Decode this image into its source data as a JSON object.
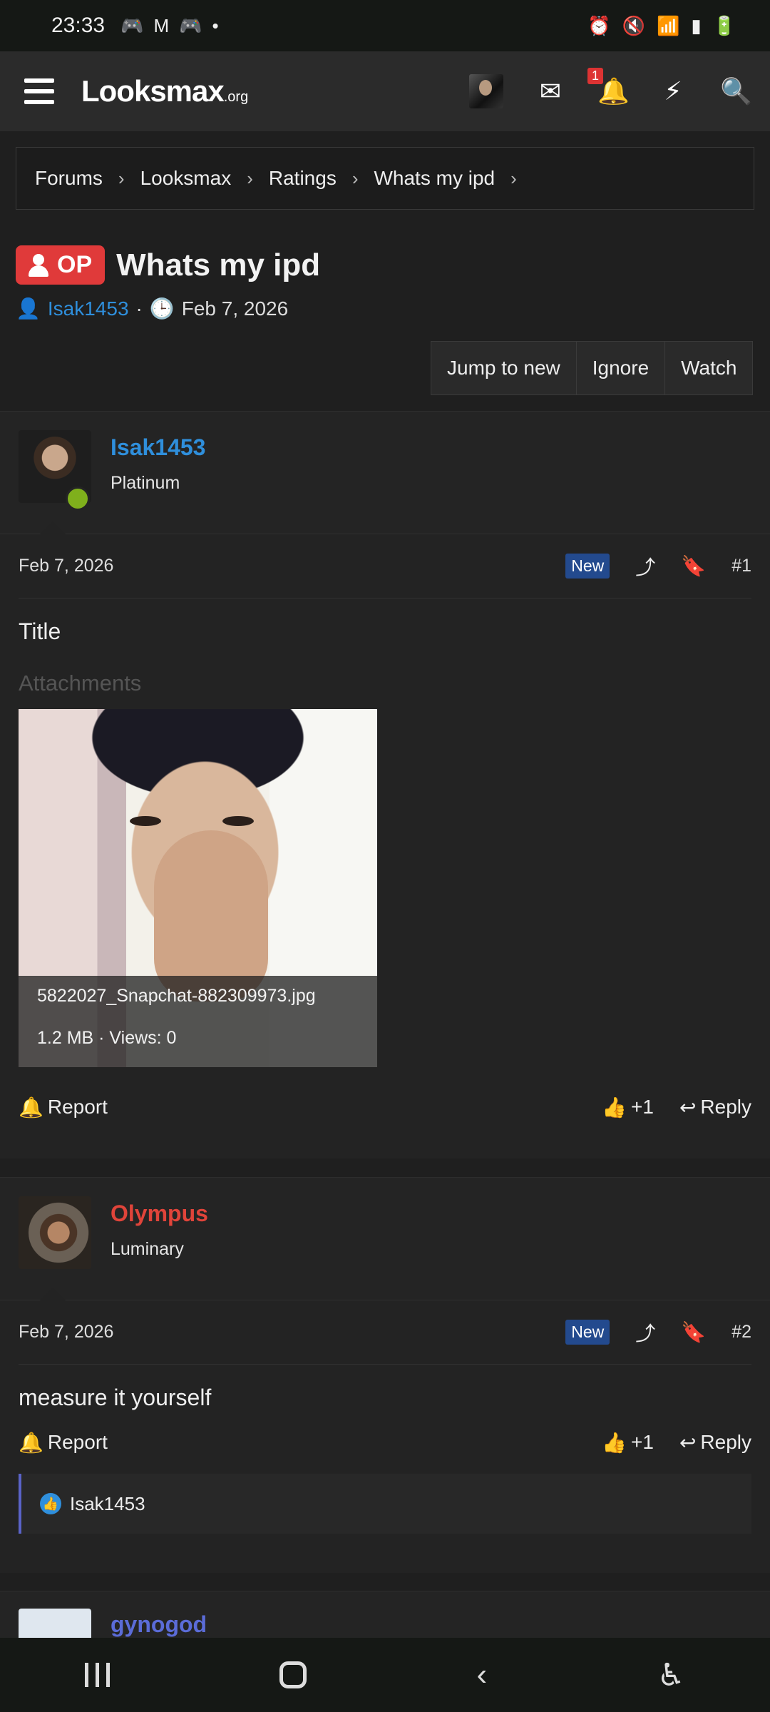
{
  "status": {
    "time": "23:33",
    "left_icons": [
      "game-icon",
      "gmail-icon",
      "game-icon",
      "dot"
    ],
    "right_icons": [
      "alarm-icon",
      "mute-icon",
      "wifi-icon",
      "signal-icon",
      "battery-icon"
    ]
  },
  "nav": {
    "logo": "Looksmax",
    "logo_suffix": ".org",
    "notif_count": "1"
  },
  "breadcrumb": [
    "Forums",
    "Looksmax",
    "Ratings",
    "Whats my ipd"
  ],
  "thread": {
    "op_label": "OP",
    "title": "Whats my ipd",
    "author": "Isak1453",
    "date": "Feb 7, 2026",
    "buttons": {
      "jump": "Jump to new",
      "ignore": "Ignore",
      "watch": "Watch"
    }
  },
  "posts": [
    {
      "name": "Isak1453",
      "name_color": "#2f8fdc",
      "rank": "Platinum",
      "date": "Feb 7, 2026",
      "new_label": "New",
      "number": "#1",
      "body": "Title",
      "attachments_label": "Attachments",
      "attachment_file": "5822027_Snapchat-882309973.jpg",
      "attachment_meta": "1.2 MB · Views: 0",
      "report": "Report",
      "like": "+1",
      "reply": "Reply"
    },
    {
      "name": "Olympus",
      "name_color": "#e0443a",
      "rank": "Luminary",
      "date": "Feb 7, 2026",
      "new_label": "New",
      "number": "#2",
      "body": "measure it yourself",
      "report": "Report",
      "like": "+1",
      "reply": "Reply",
      "reaction_user": "Isak1453"
    },
    {
      "name": "gynogod",
      "name_color": "#5b6cd8"
    }
  ]
}
